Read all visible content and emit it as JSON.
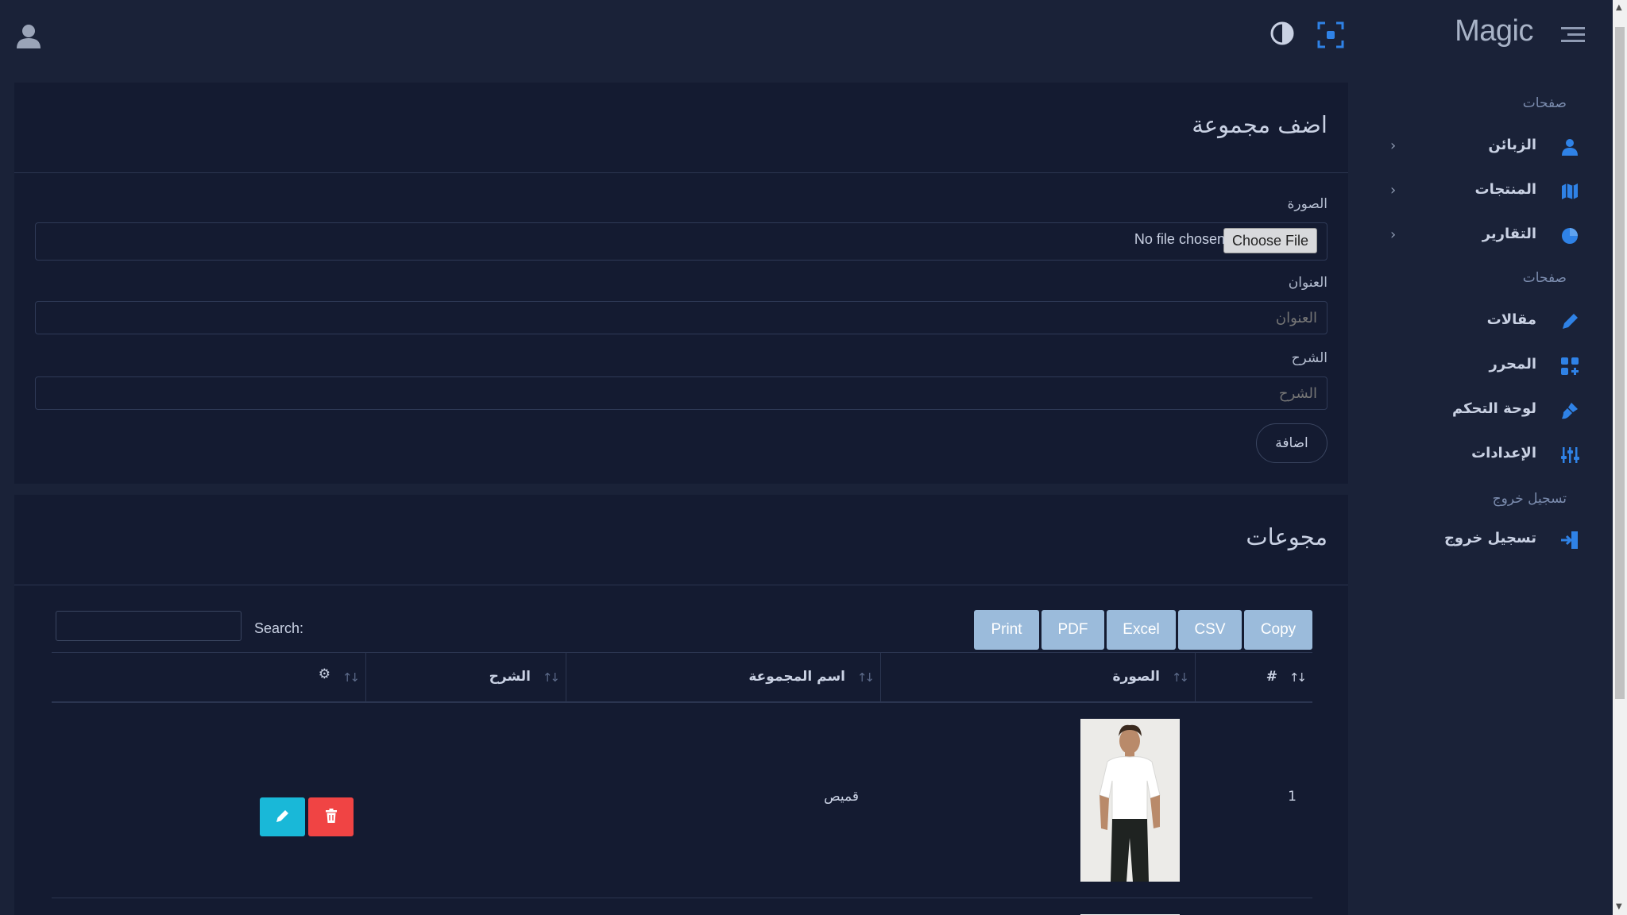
{
  "app": {
    "brand": "Magic"
  },
  "sidebar": {
    "heading_pages": "صفحات",
    "heading_pages2": "صفحات",
    "heading_logout": "تسجيل خروج",
    "items": [
      {
        "label": "الزبائن",
        "icon": "user-icon"
      },
      {
        "label": "المنتجات",
        "icon": "map-icon"
      },
      {
        "label": "التقارير",
        "icon": "pie-chart-icon"
      },
      {
        "label": "مقالات",
        "icon": "pencil-icon"
      },
      {
        "label": "المحرر",
        "icon": "grid-plus-icon"
      },
      {
        "label": "لوحة التحكم",
        "icon": "brush-icon"
      },
      {
        "label": "الإعدادات",
        "icon": "sliders-icon"
      },
      {
        "label": "تسجيل خروج",
        "icon": "sign-out-icon"
      }
    ]
  },
  "form": {
    "title": "اضف مجموعة",
    "image_label": "الصورة",
    "choose_file": "Choose File",
    "no_file": "No file chosen",
    "title_label": "العنوان",
    "title_placeholder": "العنوان",
    "desc_label": "الشرح",
    "desc_placeholder": "الشرح",
    "submit": "اضافة"
  },
  "groups": {
    "title": "مجوعات",
    "export_buttons": [
      "Copy",
      "CSV",
      "Excel",
      "PDF",
      "Print"
    ],
    "search_label": "Search:",
    "columns": {
      "index": "#",
      "image": "الصورة",
      "name": "اسم المجموعة",
      "desc": "الشرح",
      "actions": "⚙"
    },
    "rows": [
      {
        "index": "1",
        "image": "product-photo-tshirt",
        "name": "قميص",
        "desc": ""
      }
    ]
  },
  "colors": {
    "background": "#1a2238",
    "card": "#141b31",
    "accent": "#2f82e6",
    "export_button": "#9bbbdb",
    "edit_button": "#19b8d8",
    "delete_button": "#f04444"
  }
}
